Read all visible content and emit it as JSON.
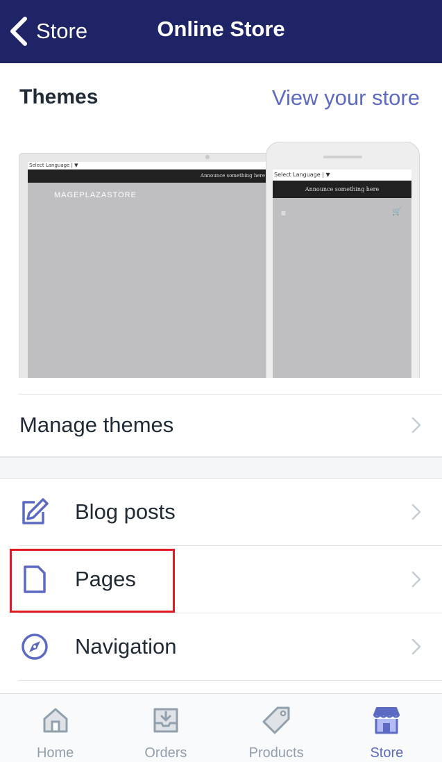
{
  "header": {
    "back_label": "Store",
    "title": "Online Store"
  },
  "themes": {
    "heading": "Themes",
    "view_store_link": "View your store",
    "preview": {
      "laptop_lang": "Select Language | ▼",
      "laptop_announcement": "Announce something here",
      "laptop_store_name": "MAGEPLAZASTORE",
      "phone_lang": "Select Language | ▼",
      "phone_announcement": "Announce something here",
      "menu_glyph": "≡",
      "cart_glyph": "🛒"
    }
  },
  "manage_themes": {
    "label": "Manage themes"
  },
  "menu_items": [
    {
      "label": "Blog posts",
      "icon": "edit-icon"
    },
    {
      "label": "Pages",
      "icon": "page-icon"
    },
    {
      "label": "Navigation",
      "icon": "compass-icon"
    }
  ],
  "tabs": [
    {
      "label": "Home",
      "icon": "home-icon",
      "active": false
    },
    {
      "label": "Orders",
      "icon": "orders-icon",
      "active": false
    },
    {
      "label": "Products",
      "icon": "tag-icon",
      "active": false
    },
    {
      "label": "Store",
      "icon": "store-icon",
      "active": true
    }
  ],
  "colors": {
    "header_bg": "#1f2466",
    "accent": "#5c6ac4",
    "tab_inactive": "#919eab",
    "highlight_box": "#e01b22"
  }
}
